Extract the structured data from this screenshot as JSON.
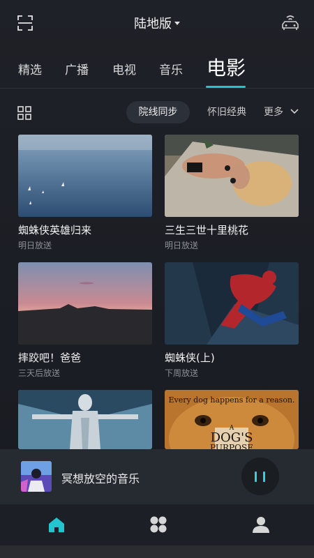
{
  "header": {
    "title": "陆地版",
    "scan_icon": "scan-icon",
    "car_icon": "car-connect-icon"
  },
  "tabs": [
    {
      "label": "精选",
      "active": false
    },
    {
      "label": "广播",
      "active": false
    },
    {
      "label": "电视",
      "active": false
    },
    {
      "label": "音乐",
      "active": false
    },
    {
      "label": "电影",
      "active": true
    }
  ],
  "filters": {
    "chips": [
      "院线同步",
      "怀旧经典"
    ],
    "selected": "院线同步",
    "more": "更多"
  },
  "movies": [
    {
      "title": "蜘蛛侠英雄归来",
      "subtitle": "明日放送"
    },
    {
      "title": "三生三世十里桃花",
      "subtitle": "明日放送"
    },
    {
      "title": "摔跤吧！爸爸",
      "subtitle": "三天后放送"
    },
    {
      "title": "蜘蛛侠(上)",
      "subtitle": "下周放送"
    },
    {
      "title": "",
      "subtitle": ""
    },
    {
      "title": "",
      "subtitle": ""
    }
  ],
  "poster_text": {
    "dog_tagline": "Every dog happens for a reason.",
    "dog_title_a": "A",
    "dog_title_b": "DOG'S",
    "dog_title_c": "PURPOSE"
  },
  "player": {
    "song": "冥想放空的音乐",
    "state": "playing"
  },
  "nav": [
    "home-icon",
    "apps-icon",
    "profile-icon"
  ],
  "colors": {
    "accent": "#23c4cf",
    "background": "#1e2127",
    "player": "#262a31"
  }
}
